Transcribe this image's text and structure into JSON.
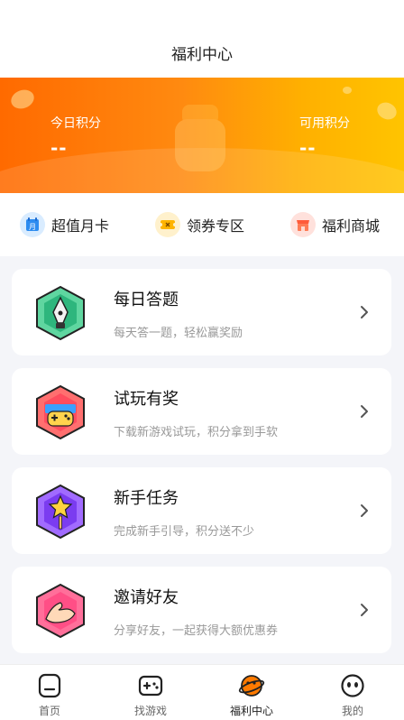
{
  "header": {
    "title": "福利中心"
  },
  "banner": {
    "today_points_label": "今日积分",
    "today_points_value": "--",
    "available_points_label": "可用积分",
    "available_points_value": "--"
  },
  "quick_links": [
    {
      "label": "超值月卡",
      "icon": "calendar-icon"
    },
    {
      "label": "领券专区",
      "icon": "coupon-icon"
    },
    {
      "label": "福利商城",
      "icon": "shop-icon"
    }
  ],
  "cards": [
    {
      "title": "每日答题",
      "desc": "每天答一题，轻松赢奖励",
      "icon": "pen-nib-icon"
    },
    {
      "title": "试玩有奖",
      "desc": "下载新游戏试玩，积分拿到手软",
      "icon": "gamepad-icon"
    },
    {
      "title": "新手任务",
      "desc": "完成新手引导，积分送不少",
      "icon": "star-wand-icon"
    },
    {
      "title": "邀请好友",
      "desc": "分享好友，一起获得大额优惠券",
      "icon": "handshake-icon"
    }
  ],
  "tabs": [
    {
      "label": "首页",
      "icon": "home-icon"
    },
    {
      "label": "找游戏",
      "icon": "gamepad-icon"
    },
    {
      "label": "福利中心",
      "icon": "planet-icon",
      "active": true
    },
    {
      "label": "我的",
      "icon": "profile-face-icon"
    }
  ],
  "colors": {
    "banner_start": "#ff6a00",
    "banner_end": "#ffc400",
    "accent": "#ff7a00",
    "text_primary": "#111111",
    "text_secondary": "#999999"
  }
}
